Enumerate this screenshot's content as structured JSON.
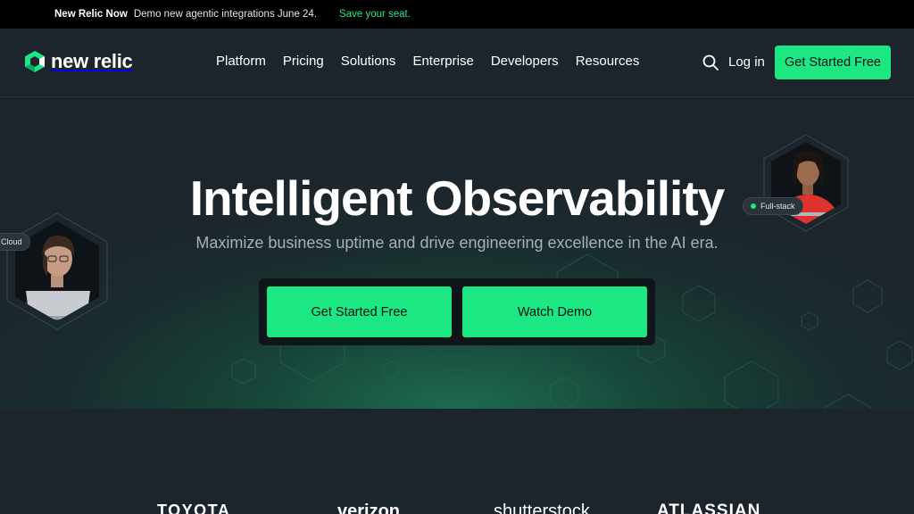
{
  "announcement": {
    "brand": "New Relic Now",
    "message": "Demo new agentic integrations June 24.",
    "cta": "Save your seat."
  },
  "nav": {
    "logo_text": "new relic",
    "logo_mark": "",
    "items": [
      "Platform",
      "Pricing",
      "Solutions",
      "Enterprise",
      "Developers",
      "Resources"
    ],
    "search_icon": "search-icon",
    "login": "Log in",
    "cta": "Get Started Free"
  },
  "hero": {
    "title": "Intelligent Observability",
    "subtitle": "Maximize business uptime and drive engineering excellence in the AI era.",
    "primary_cta": "Get Started Free",
    "secondary_cta": "Watch Demo",
    "tags": {
      "left": "Cloud",
      "right": "Full-stack"
    }
  },
  "customers": [
    "TOYOTA",
    "verizon",
    "shutterstock",
    "ATLASSIAN"
  ],
  "colors": {
    "accent": "#1ce783",
    "background": "#1d252c",
    "topbar": "#000000",
    "button_text": "#0c1217"
  }
}
